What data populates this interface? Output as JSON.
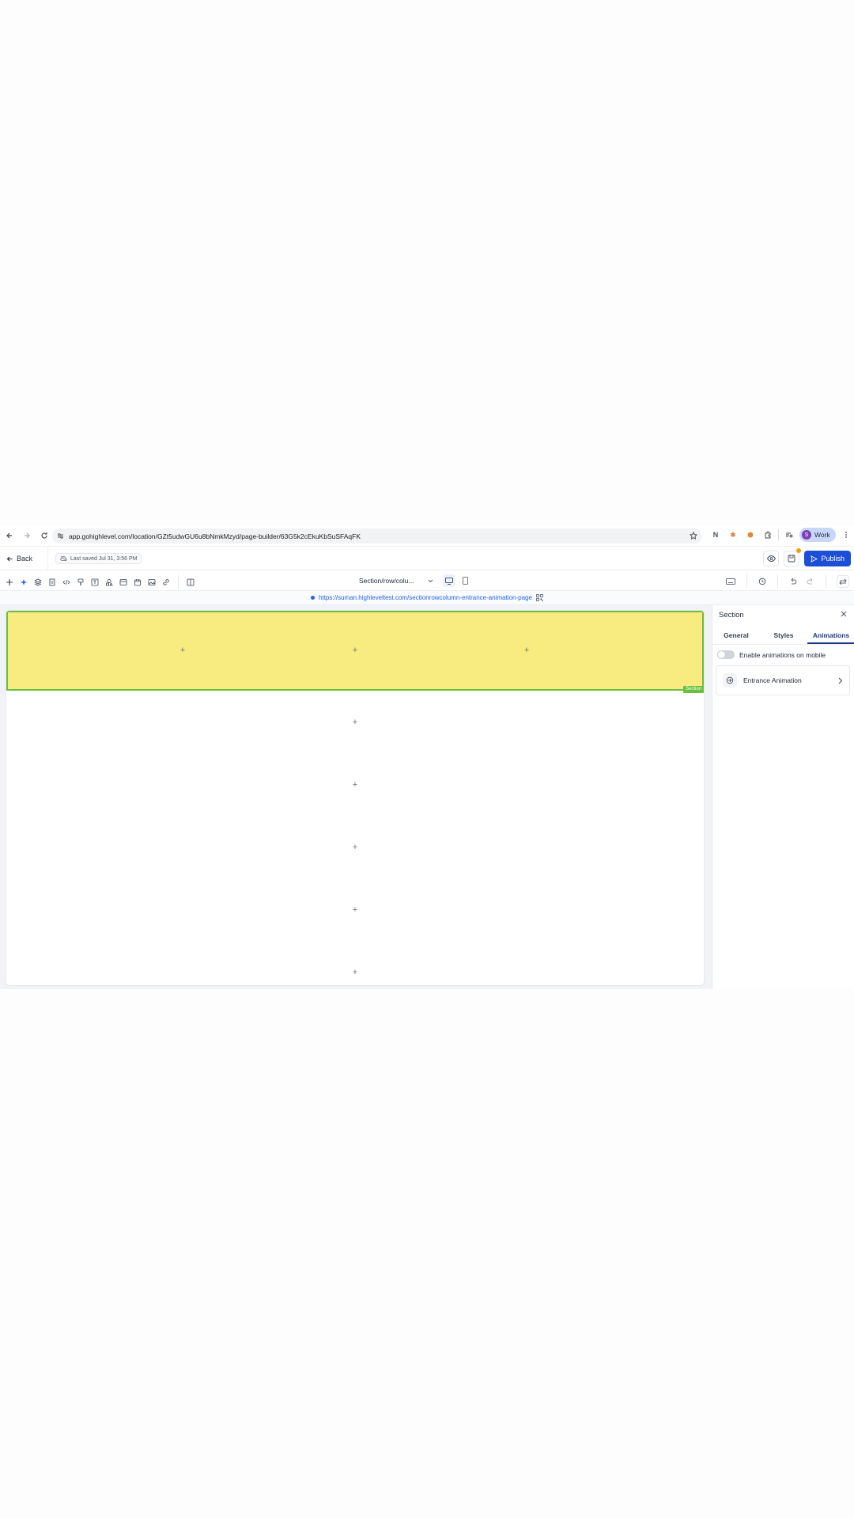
{
  "browser": {
    "url": "app.gohighlevel.com/location/GZt5udwGU6u8bNmkMzyd/page-builder/63G5k2cEkuKbSuSFAqFK",
    "profile_label": "Work",
    "profile_initial": "S"
  },
  "header": {
    "back_label": "Back",
    "last_saved": "Last saved Jul 31, 3:56 PM",
    "publish_label": "Publish"
  },
  "toolbar": {
    "page_selector": "Section/row/colu..."
  },
  "url_strip": {
    "live_url": "https://suman.highleveltest.com/sectionrowcolumn-entrance-animation-page"
  },
  "canvas": {
    "section_tag": "Section",
    "plus_symbol": "+"
  },
  "panel": {
    "title": "Section",
    "tabs": [
      {
        "label": "General"
      },
      {
        "label": "Styles"
      },
      {
        "label": "Animations"
      }
    ],
    "mobile_toggle_label": "Enable animations on mobile",
    "entrance_animation_label": "Entrance Animation"
  },
  "colors": {
    "section_fill": "#f8ec81",
    "section_border": "#6bbf3d",
    "publish_blue": "#1d4ed8",
    "active_tab": "#1e3a8a"
  }
}
